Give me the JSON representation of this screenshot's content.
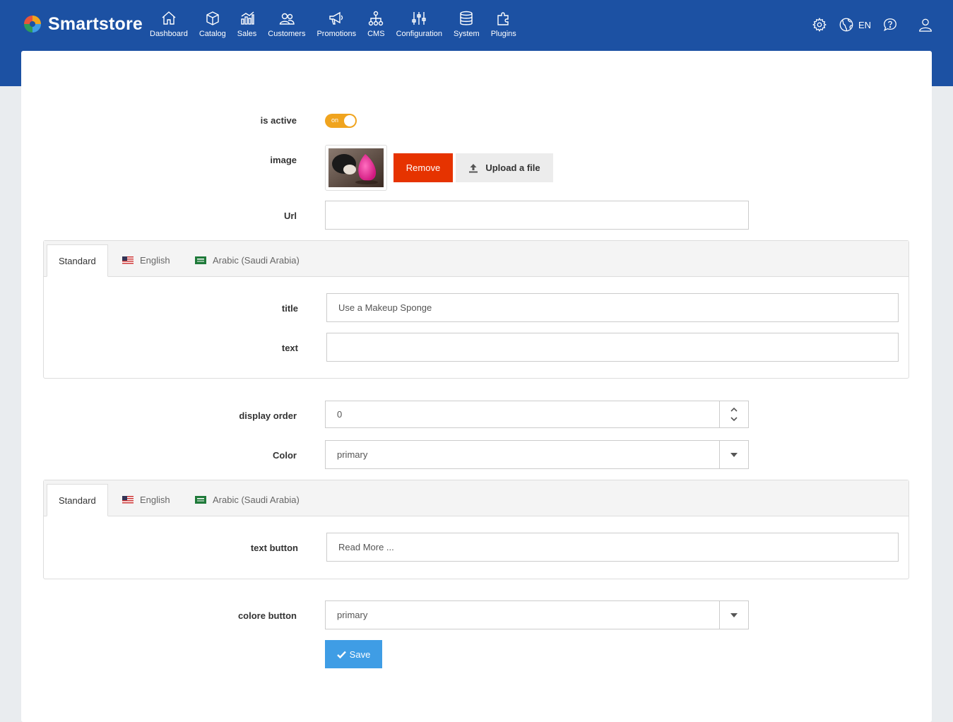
{
  "brand": {
    "name": "Smartstore"
  },
  "nav": [
    {
      "label": "Dashboard",
      "icon": "home-icon"
    },
    {
      "label": "Catalog",
      "icon": "box-icon"
    },
    {
      "label": "Sales",
      "icon": "chart-icon"
    },
    {
      "label": "Customers",
      "icon": "users-icon"
    },
    {
      "label": "Promotions",
      "icon": "megaphone-icon"
    },
    {
      "label": "CMS",
      "icon": "sitemap-icon"
    },
    {
      "label": "Configuration",
      "icon": "sliders-icon"
    },
    {
      "label": "System",
      "icon": "database-icon"
    },
    {
      "label": "Plugins",
      "icon": "puzzle-icon"
    }
  ],
  "topright": {
    "language": "EN"
  },
  "form": {
    "is_active_label": "is active",
    "toggle_text": "on",
    "image_label": "image",
    "remove_label": "Remove",
    "upload_label": "Upload a file",
    "url_label": "Url",
    "url_value": "",
    "tabs": [
      "Standard",
      "English",
      "Arabic (Saudi Arabia)"
    ],
    "title_label": "title",
    "title_value": "Use a Makeup Sponge",
    "text_label": "text",
    "text_value": "",
    "display_order_label": "display order",
    "display_order_value": "0",
    "color_label": "Color",
    "color_value": "primary",
    "text_button_label": "text button",
    "text_button_value": "Read More ...",
    "colore_button_label": "colore button",
    "colore_button_value": "primary",
    "save_label": "Save"
  },
  "colors": {
    "header": "#1c51a3",
    "toggle": "#f0a41e",
    "remove": "#e63300",
    "save": "#3f9de5"
  }
}
